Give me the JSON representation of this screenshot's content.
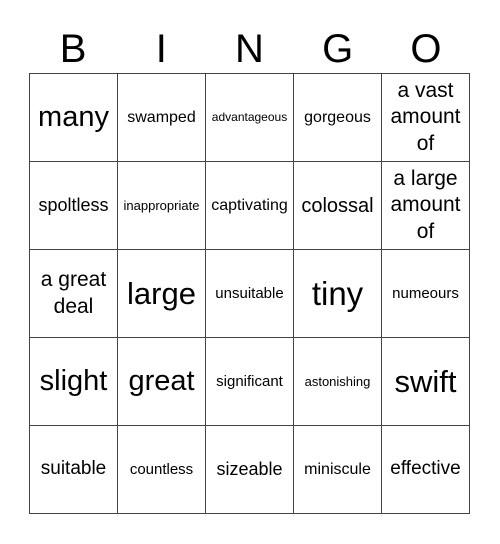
{
  "header": [
    "B",
    "I",
    "N",
    "G",
    "O"
  ],
  "cells": [
    [
      "many",
      "swamped",
      "advantageous",
      "gorgeous",
      "a vast amount of"
    ],
    [
      "spoltless",
      "inappropriate",
      "captivating",
      "colossal",
      "a large amount of"
    ],
    [
      "a great deal",
      "large",
      "unsuitable",
      "tiny",
      "numeours"
    ],
    [
      "slight",
      "great",
      "significant",
      "astonishing",
      "swift"
    ],
    [
      "suitable",
      "countless",
      "sizeable",
      "miniscule",
      "effective"
    ]
  ]
}
